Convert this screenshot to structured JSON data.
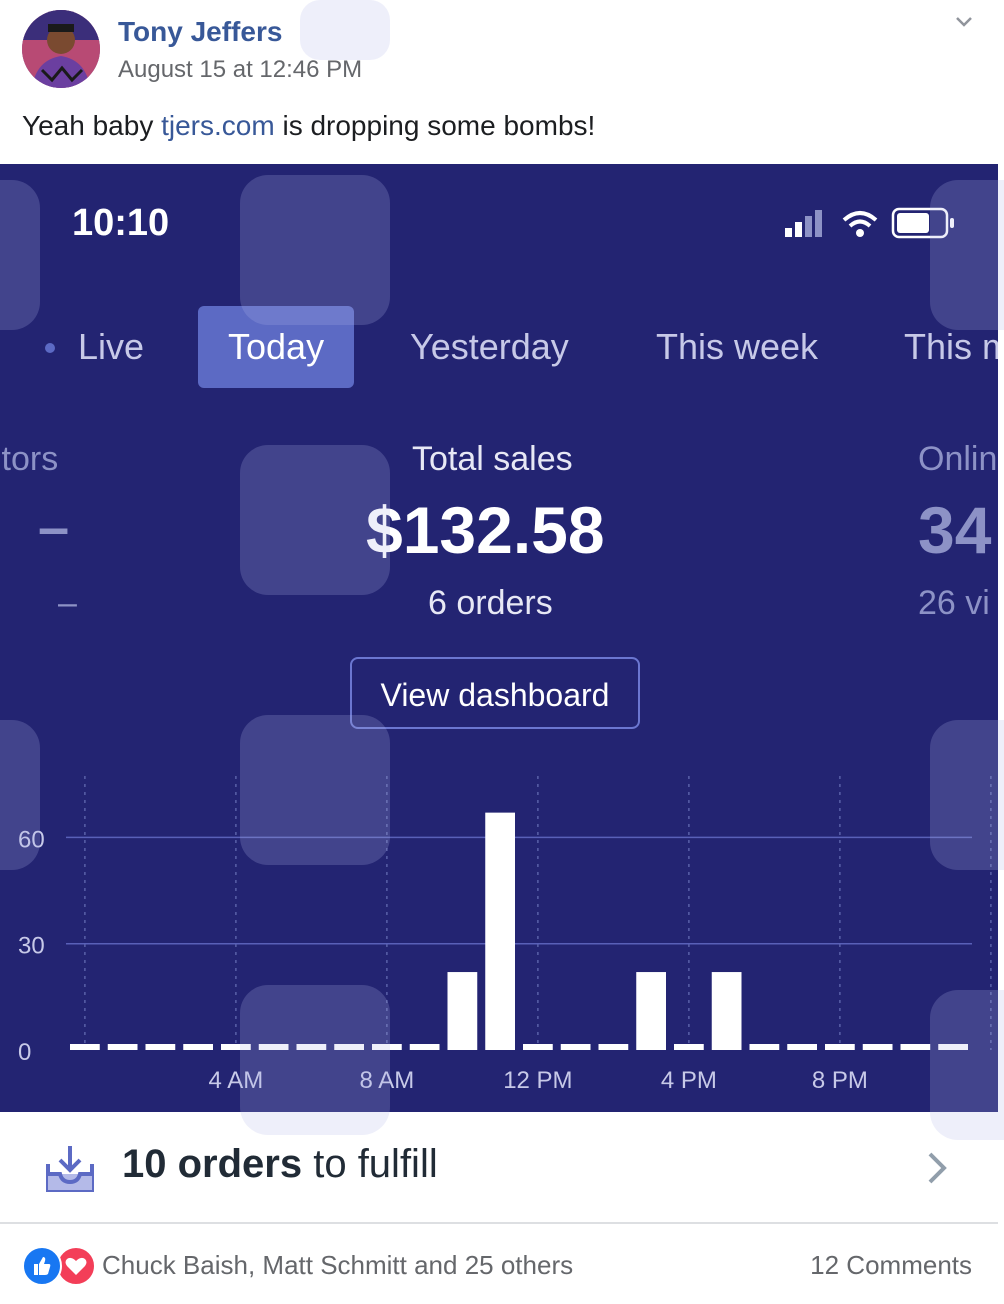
{
  "post": {
    "author": "Tony Jeffers",
    "timestamp": "August 15 at 12:46 PM",
    "text_before": "Yeah baby ",
    "link": "tjers.com",
    "text_after": " is dropping some bombs!"
  },
  "phone": {
    "status_time": "10:10",
    "tabs": [
      "Live",
      "Today",
      "Yesterday",
      "This week",
      "This m"
    ],
    "active_tab": "Today",
    "metrics": {
      "left_label": "itors",
      "left_value": "–",
      "left_sub": "–",
      "center_label": "Total sales",
      "center_value": "$132.58",
      "center_sub": "6 orders",
      "right_label": "Onlin",
      "right_value": "34",
      "right_sub": "26 vi"
    },
    "view_dashboard": "View dashboard"
  },
  "chart_data": {
    "type": "bar",
    "title": "",
    "xlabel": "",
    "ylabel": "",
    "y_ticks": [
      "0",
      "30",
      "60"
    ],
    "x_ticks": [
      "4 AM",
      "8 AM",
      "12 PM",
      "4 PM",
      "8 PM"
    ],
    "ylim": [
      0,
      70
    ],
    "values": [
      0,
      0,
      0,
      0,
      0,
      0,
      0,
      0,
      0,
      0,
      22,
      67,
      0,
      0,
      0,
      22,
      0,
      22,
      0,
      0,
      0,
      0,
      0,
      0
    ]
  },
  "fulfill": {
    "bold": "10 orders",
    "rest": " to fulfill"
  },
  "reactions": {
    "names": "Chuck Baish, Matt Schmitt and 25 others",
    "comments": "12 Comments"
  },
  "icons": {
    "menu": "chevron-down-icon",
    "signal": "signal-icon",
    "wifi": "wifi-icon",
    "battery": "battery-icon",
    "fulfill": "inbox-download-icon",
    "chevron": "chevron-right-icon",
    "like": "like-icon",
    "love": "love-icon"
  },
  "colors": {
    "phone_bg": "#232472",
    "tab_active": "#5c6ac4",
    "link": "#385898",
    "bar": "#ffffff"
  }
}
